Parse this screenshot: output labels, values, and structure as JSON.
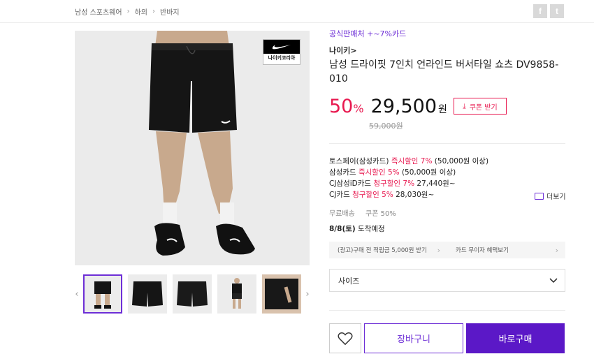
{
  "breadcrumb": [
    "남성 스포츠웨어",
    "하의",
    "반바지"
  ],
  "share": {
    "facebook": "f",
    "twitter": "t"
  },
  "badge": {
    "text": "나이키코리아"
  },
  "product": {
    "official": "공식판매처 +~7%카드",
    "brand": "나이키>",
    "title": "남성 드라이핏 7인치 언라인드 버서타일 쇼츠 DV9858-010",
    "discount": "50",
    "discount_unit": "%",
    "price": "29,500",
    "price_unit": "원",
    "original_price": "59,000원",
    "coupon_label": "쿠폰 받기"
  },
  "benefits": [
    {
      "pre": "토스페이(삼성카드) ",
      "hl": "즉시할인 7%",
      "post": " (50,000원 이상)"
    },
    {
      "pre": "삼성카드 ",
      "hl": "즉시할인 5%",
      "post": " (50,000원 이상)"
    },
    {
      "pre": "CJ삼성iD카드 ",
      "hl": "청구할인 7%",
      "post": " 27,440원~"
    },
    {
      "pre": "CJ카드 ",
      "hl": "청구할인 5%",
      "post": " 28,030원~"
    }
  ],
  "more_label": "더보기",
  "shipping": {
    "free": "무료배송",
    "coupon": "쿠폰 50%"
  },
  "arrival": {
    "date": "8/8(토)",
    "text": " 도착예정"
  },
  "promo": {
    "left": "(광고)구매 전 적립금 5,000원 받기",
    "right": "카드 무이자 혜택보기"
  },
  "size": {
    "label": "사이즈"
  },
  "buttons": {
    "cart": "장바구니",
    "buy": "바로구매"
  },
  "colors": {
    "accent": "#6d2ed6",
    "sale": "#e8184f",
    "buy": "#5b18c7"
  }
}
